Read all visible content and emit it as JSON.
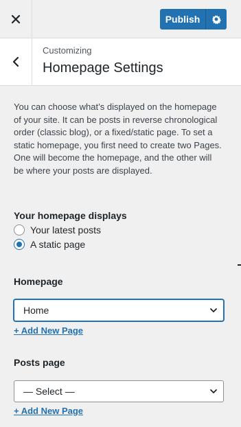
{
  "topbar": {
    "close_icon": "close-icon",
    "publish_label": "Publish",
    "settings_icon": "gear-icon",
    "accent": "#2271b1"
  },
  "header": {
    "back_icon": "chevron-left-icon",
    "section": "Customizing",
    "title": "Homepage Settings"
  },
  "description": "You can choose what’s displayed on the homepage of your site. It can be posts in reverse chronological order (classic blog), or a fixed/static page. To set a static homepage, you first need to create two Pages. One will become the homepage, and the other will be where your posts are displayed.",
  "homepage_displays": {
    "label": "Your homepage displays",
    "options": [
      {
        "label": "Your latest posts",
        "checked": false
      },
      {
        "label": "A static page",
        "checked": true
      }
    ]
  },
  "homepage": {
    "label": "Homepage",
    "selected": "Home",
    "add_link": "+ Add New Page"
  },
  "posts_page": {
    "label": "Posts page",
    "selected": "— Select —",
    "add_link": "+ Add New Page"
  }
}
